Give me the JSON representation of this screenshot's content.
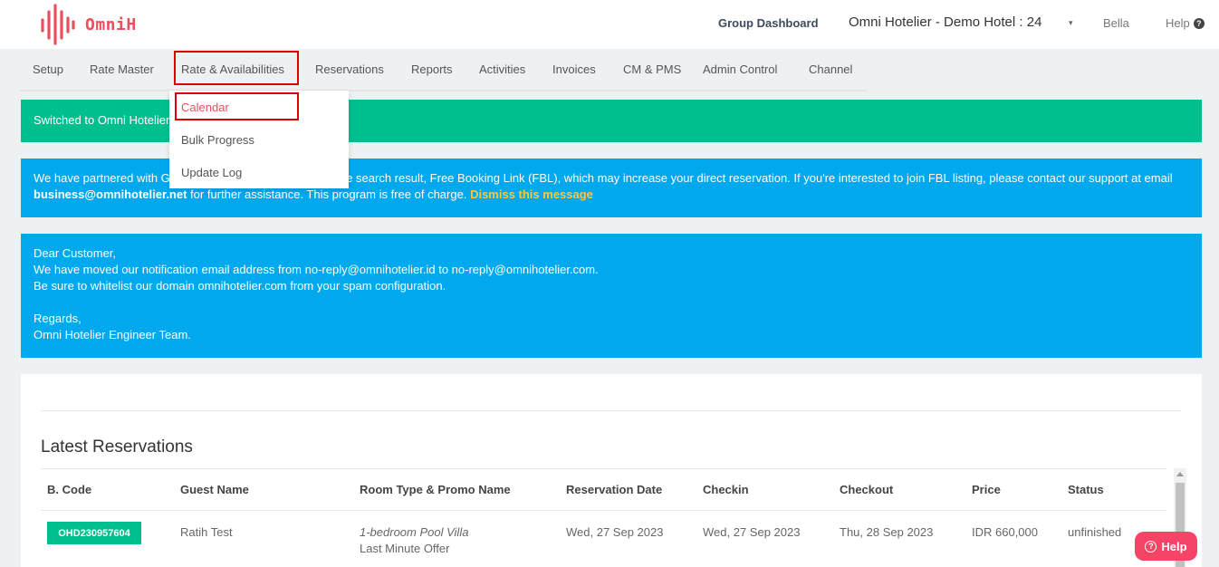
{
  "brand": {
    "name": "OmniH",
    "color": "#ea4f5e"
  },
  "header": {
    "group_dashboard": "Group Dashboard",
    "hotel_selector": "Omni Hotelier - Demo Hotel : 24",
    "caret": "▾",
    "user": "Bella",
    "help": "Help",
    "help_icon": "?"
  },
  "nav": {
    "items": [
      "Setup",
      "Rate Master",
      "Rate & Availabilities",
      "Reservations",
      "Reports",
      "Activities",
      "Invoices",
      "CM & PMS",
      "Admin Control",
      "Channel"
    ]
  },
  "dropdown": {
    "items": [
      "Calendar",
      "Bulk Progress",
      "Update Log"
    ]
  },
  "alerts": {
    "switched": "Switched to Omni Hotelier - Demo Hotel : 24",
    "fbl_part1": "We have partnered with Google to show your hotel on google search result, Free Booking Link (FBL), which may increase your direct reservation. If you're interested to join FBL listing, please contact our support at email ",
    "fbl_email": "business@omnihotelier.net",
    "fbl_part2": " for further assistance. This program is free of charge. ",
    "fbl_dismiss": "Dismiss this message",
    "notice_lines": [
      "Dear Customer,",
      "We have moved our notification email address from no-reply@omnihotelier.id to no-reply@omnihotelier.com.",
      "Be sure to whitelist our domain omnihotelier.com from your spam configuration.",
      "",
      "Regards,",
      "Omni Hotelier Engineer Team."
    ]
  },
  "reservations": {
    "title": "Latest Reservations",
    "columns": [
      "B. Code",
      "Guest Name",
      "Room Type & Promo Name",
      "Reservation Date",
      "Checkin",
      "Checkout",
      "Price",
      "Status"
    ],
    "rows": [
      {
        "code": "OHD230957604",
        "guest": "Ratih Test",
        "room": "1-bedroom Pool Villa",
        "promo": "Last Minute Offer",
        "reservation_date": "Wed, 27 Sep 2023",
        "checkin": "Wed, 27 Sep 2023",
        "checkout": "Thu, 28 Sep 2023",
        "price": "IDR 660,000",
        "status": "unfinished"
      }
    ]
  },
  "floating_help": {
    "label": "Help",
    "icon": "?"
  },
  "colors": {
    "green": "#00bf8f",
    "blue": "#00a8ee",
    "dismiss": "#ffc83d",
    "help_button": "#f54466",
    "highlight": "#e00000"
  }
}
